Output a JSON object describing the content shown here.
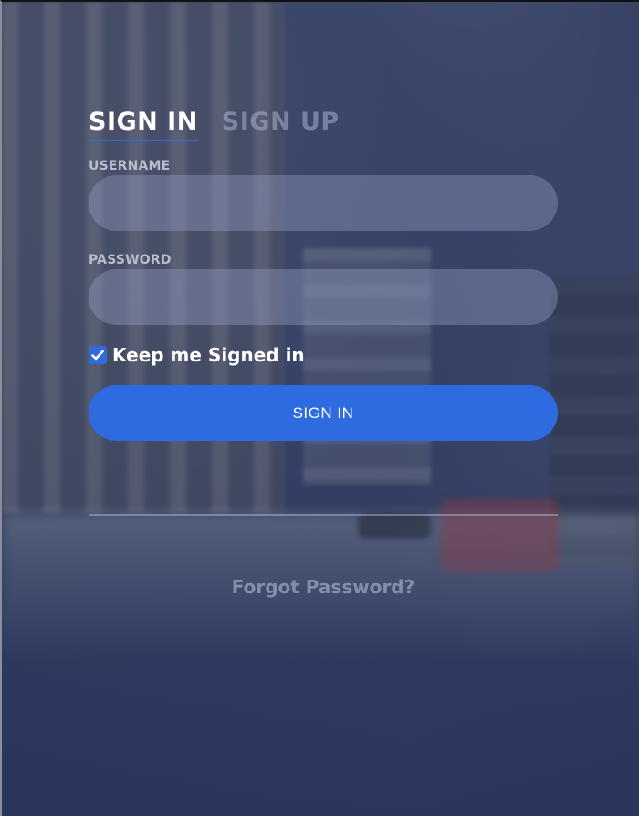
{
  "tabs": [
    {
      "label": "SIGN IN",
      "active": true
    },
    {
      "label": "SIGN UP",
      "active": false
    }
  ],
  "form": {
    "username_label": "USERNAME",
    "username_value": "",
    "password_label": "PASSWORD",
    "password_value": "",
    "remember_label": "Keep me Signed in",
    "remember_checked": true,
    "submit_label": "SIGN IN",
    "forgot_label": "Forgot Password?"
  },
  "colors": {
    "accent": "#2e6be0",
    "overlay": "#34426e"
  },
  "icons": {
    "checkbox": "checkmark-icon"
  }
}
